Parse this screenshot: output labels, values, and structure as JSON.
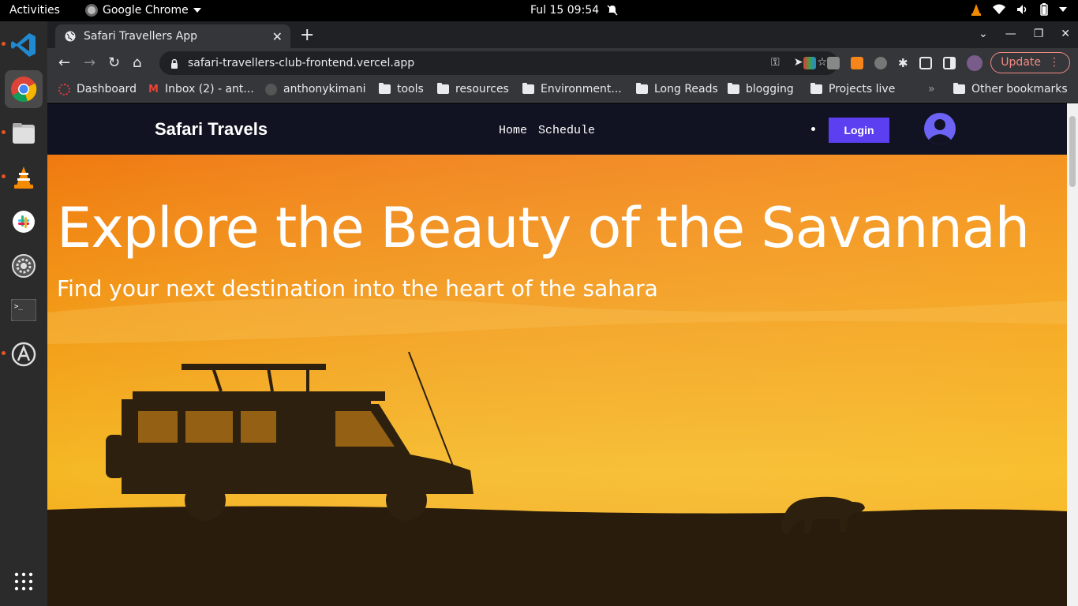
{
  "topbar": {
    "activities": "Activities",
    "app_name": "Google Chrome",
    "clock": "Ful 15  09:54"
  },
  "dock": {
    "apps": [
      "vscode-icon",
      "chrome-icon",
      "files-icon",
      "vlc-icon",
      "slack-icon",
      "settings-icon",
      "terminal-icon",
      "software-icon",
      "app-grid-icon"
    ]
  },
  "browser": {
    "tab_title": "Safari Travellers App",
    "url": "safari-travellers-club-frontend.vercel.app",
    "update_label": "Update",
    "bookmarks": [
      "Dashboard",
      "Inbox (2) - ant...",
      "anthonykimani",
      "tools",
      "resources",
      "Environment...",
      "Long Reads",
      "blogging",
      "Projects live"
    ],
    "more_bookmarks": "»",
    "other_bookmarks": "Other bookmarks"
  },
  "site": {
    "brand": "Safari Travels",
    "nav": [
      "Home",
      "Schedule"
    ],
    "login_label": "Login",
    "hero_title": "Explore the Beauty of the Savannah",
    "hero_subtitle": "Find your next destination into the heart of the sahara"
  },
  "colors": {
    "navbar_bg": "#111322",
    "login_bg": "#5b3ff0",
    "hero_sky_top": "#f07a10",
    "hero_sky_mid": "#f5b824"
  }
}
